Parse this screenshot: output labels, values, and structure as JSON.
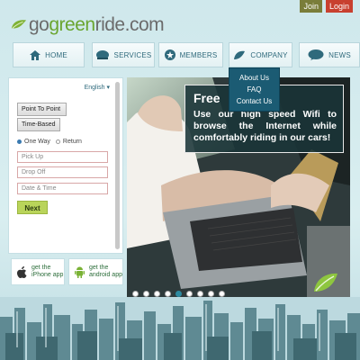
{
  "brand": {
    "part1": "go",
    "part2": "green",
    "part3": "ride",
    "part4": ".com"
  },
  "auth": {
    "join": "Join",
    "login": "Login"
  },
  "nav": {
    "home": "HOME",
    "services": "SERVICES",
    "members": "MEMBERS",
    "company": "COMPANY",
    "news": "NEWS"
  },
  "company_menu": [
    "About Us",
    "FAQ",
    "Contact Us"
  ],
  "booking": {
    "language": "English",
    "point_to_point": "Point To Point",
    "time_based": "Time-Based",
    "one_way": "One Way",
    "return": "Return",
    "pickup_placeholder": "Pick Up",
    "dropoff_placeholder": "Drop Off",
    "datetime_placeholder": "Date & Time",
    "next": "Next"
  },
  "apps": {
    "iphone_line1": "get the",
    "iphone_line2": "iPhone app",
    "android_line1": "get the",
    "android_line2": "android app"
  },
  "slide": {
    "title": "Free",
    "text": "Use our high speed Wifi to browse the Internet while comfortably riding in our cars!"
  },
  "slider": {
    "slide_count": 9,
    "active_index": 4
  },
  "colors": {
    "accent": "#2f6a7c",
    "green": "#6aa52f",
    "login": "#c8402f",
    "join": "#7a7d3a",
    "menu": "#1b5b73"
  }
}
